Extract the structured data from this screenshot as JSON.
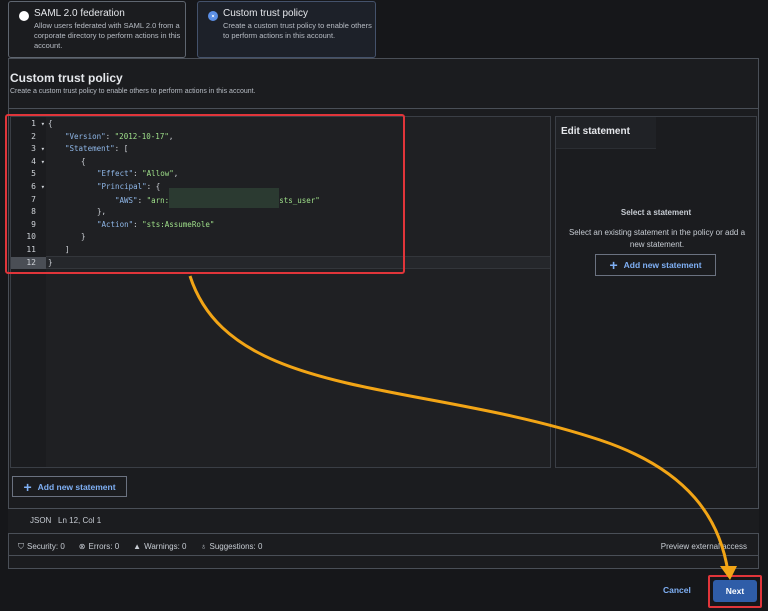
{
  "options": [
    {
      "title": "SAML 2.0 federation",
      "desc": "Allow users federated with SAML 2.0 from a corporate directory to perform actions in this account.",
      "selected": false
    },
    {
      "title": "Custom trust policy",
      "desc": "Create a custom trust policy to enable others to perform actions in this account.",
      "selected": true
    }
  ],
  "section": {
    "title": "Custom trust policy",
    "subtitle": "Create a custom trust policy to enable others to perform actions in this account."
  },
  "editor": {
    "lines": [
      "1",
      "2",
      "3",
      "4",
      "5",
      "6",
      "7",
      "8",
      "9",
      "10",
      "11",
      "12"
    ],
    "code": {
      "l1": "{",
      "l2k": "\"Version\"",
      "l2v": "\"2012-10-17\"",
      "l3k": "\"Statement\"",
      "l3p": ": [",
      "l4": "{",
      "l5k": "\"Effect\"",
      "l5v": "\"Allow\"",
      "l6k": "\"Principal\"",
      "l6p": ": {",
      "l7k": "\"AWS\"",
      "l7v1": "\"arn:",
      "l7v2": "sts_user\"",
      "l8": "},",
      "l9k": "\"Action\"",
      "l9v": "\"sts:AssumeRole\"",
      "l10": "}",
      "l11": "]",
      "l12": "}"
    },
    "add_statement": "Add new statement",
    "mode": "JSON",
    "cursor": "Ln 12, Col 1"
  },
  "edit_panel": {
    "title": "Edit statement",
    "empty_title": "Select a statement",
    "empty_desc": "Select an existing statement in the policy or add a new statement.",
    "add_statement": "Add new statement"
  },
  "status": {
    "security": "Security: 0",
    "errors": "Errors: 0",
    "warnings": "Warnings: 0",
    "suggestions": "Suggestions: 0",
    "preview": "Preview external access"
  },
  "footer": {
    "cancel": "Cancel",
    "next": "Next"
  },
  "colors": {
    "accent": "#2f5da8",
    "highlight": "#e0353a",
    "arrow": "#f2a516"
  }
}
